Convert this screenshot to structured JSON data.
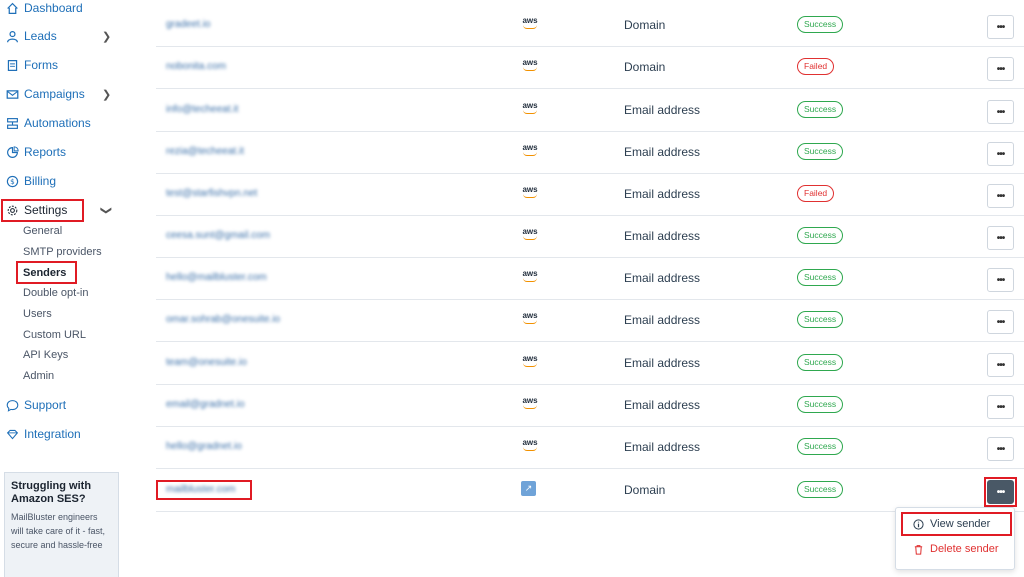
{
  "sidebar": {
    "items": [
      {
        "label": "Dashboard",
        "icon": "home-icon"
      },
      {
        "label": "Leads",
        "icon": "user-icon"
      },
      {
        "label": "Forms",
        "icon": "form-icon"
      },
      {
        "label": "Campaigns",
        "icon": "mail-icon"
      },
      {
        "label": "Automations",
        "icon": "automation-icon"
      },
      {
        "label": "Reports",
        "icon": "chart-icon"
      },
      {
        "label": "Billing",
        "icon": "dollar-icon"
      },
      {
        "label": "Settings",
        "icon": "gear-icon"
      },
      {
        "label": "Support",
        "icon": "chat-icon"
      },
      {
        "label": "Integration",
        "icon": "integration-icon"
      }
    ],
    "settings_sub": [
      "General",
      "SMTP providers",
      "Senders",
      "Double opt-in",
      "Users",
      "Custom URL",
      "API Keys",
      "Admin"
    ],
    "promo": {
      "title": "Struggling with Amazon SES?",
      "text": "MailBluster engineers will take care of it - fast, secure and hassle-free"
    }
  },
  "senders": [
    {
      "email": "gradeet.io",
      "provider": "aws",
      "type": "Domain",
      "status": "Success"
    },
    {
      "email": "nobonita.com",
      "provider": "aws",
      "type": "Domain",
      "status": "Failed"
    },
    {
      "email": "info@techeeat.it",
      "provider": "aws",
      "type": "Email address",
      "status": "Success"
    },
    {
      "email": "rezia@techeeat.it",
      "provider": "aws",
      "type": "Email address",
      "status": "Success"
    },
    {
      "email": "test@starfishvpn.net",
      "provider": "aws",
      "type": "Email address",
      "status": "Failed"
    },
    {
      "email": "ceesa.sunt@gmail.com",
      "provider": "aws",
      "type": "Email address",
      "status": "Success"
    },
    {
      "email": "hello@mailbluster.com",
      "provider": "aws",
      "type": "Email address",
      "status": "Success"
    },
    {
      "email": "omar.sohrab@onesuite.io",
      "provider": "aws",
      "type": "Email address",
      "status": "Success"
    },
    {
      "email": "team@onesuite.io",
      "provider": "aws",
      "type": "Email address",
      "status": "Success"
    },
    {
      "email": "email@gradnet.io",
      "provider": "aws",
      "type": "Email address",
      "status": "Success"
    },
    {
      "email": "hello@gradnet.io",
      "provider": "aws",
      "type": "Email address",
      "status": "Success"
    },
    {
      "email": "mailbluster.com",
      "provider": "generic",
      "type": "Domain",
      "status": "Success"
    }
  ],
  "provider_label": "aws",
  "dropdown": {
    "view": "View sender",
    "delete": "Delete sender"
  },
  "colors": {
    "link": "#1e6fb8",
    "success": "#2fa84f",
    "failed": "#e03131",
    "highlight": "#e01b24"
  }
}
